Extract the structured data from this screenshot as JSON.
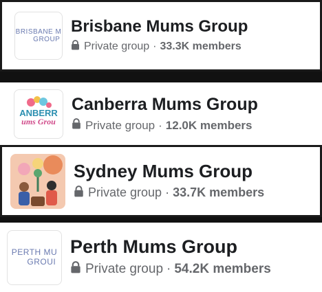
{
  "groups": [
    {
      "name": "Brisbane Mums Group",
      "privacy": "Private group",
      "separator": "·",
      "members": "33.3K members",
      "logo_text": [
        "BRISBANE M",
        "GROUP"
      ]
    },
    {
      "name": "Canberra Mums Group",
      "privacy": "Private group",
      "separator": "·",
      "members": "12.0K members",
      "logo_text": [
        "ANBERR",
        "ums Grou"
      ]
    },
    {
      "name": "Sydney Mums Group",
      "privacy": "Private group",
      "separator": "·",
      "members": "33.7K members",
      "logo_text": []
    },
    {
      "name": "Perth Mums Group",
      "privacy": "Private group",
      "separator": "·",
      "members": "54.2K members",
      "logo_text": [
        "PERTH MU",
        "GROUI"
      ]
    }
  ],
  "icons": {
    "privacy": "lock-icon"
  },
  "colors": {
    "name": "#1c1e21",
    "meta": "#65676b",
    "page_bg": "#111111",
    "card_bg": "#ffffff"
  }
}
